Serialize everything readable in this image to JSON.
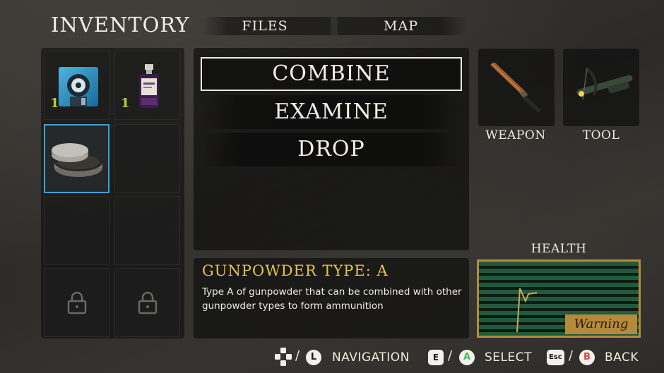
{
  "tabs": {
    "inventory": "INVENTORY",
    "files": "FILES",
    "map": "MAP"
  },
  "inventory": {
    "slots": [
      {
        "item_icon": "floppy-disk-icon",
        "count": "1"
      },
      {
        "item_icon": "chemical-bottle-icon",
        "count": "1"
      },
      {
        "item_icon": "gunpowder-tin-icon",
        "count": "",
        "selected": true
      },
      {
        "item_icon": "",
        "count": ""
      },
      {
        "item_icon": "",
        "count": ""
      },
      {
        "item_icon": "",
        "count": ""
      },
      {
        "item_icon": "lock-icon",
        "count": "",
        "locked": true
      },
      {
        "item_icon": "lock-icon",
        "count": "",
        "locked": true
      }
    ]
  },
  "menu": {
    "items": [
      "COMBINE",
      "EXAMINE",
      "DROP"
    ],
    "active_index": 0
  },
  "description": {
    "title": "GUNPOWDER TYPE: A",
    "text": "Type A of gunpowder that can be combined with other gunpowder types to form ammunition"
  },
  "equipment": {
    "weapon_label": "WEAPON",
    "weapon_icon": "knife-icon",
    "tool_label": "TOOL",
    "tool_icon": "crossbow-icon"
  },
  "health": {
    "label": "HEALTH",
    "status": "Warning"
  },
  "hints": {
    "navigation": {
      "keyboard": "WASD",
      "pad": "L",
      "label": "NAVIGATION"
    },
    "select": {
      "keyboard": "E",
      "pad": "A",
      "label": "SELECT"
    },
    "back": {
      "keyboard": "Esc",
      "pad": "B",
      "label": "BACK"
    },
    "separator": "/"
  },
  "colors": {
    "selection_border": "#3aa3d6",
    "item_count": "#b8cc3a",
    "description_title": "#e2c44a",
    "health_frame": "#b58a3c",
    "health_stripe": "#1f5a3c",
    "pad_a": "#3fbf5a",
    "pad_b": "#d94545"
  }
}
